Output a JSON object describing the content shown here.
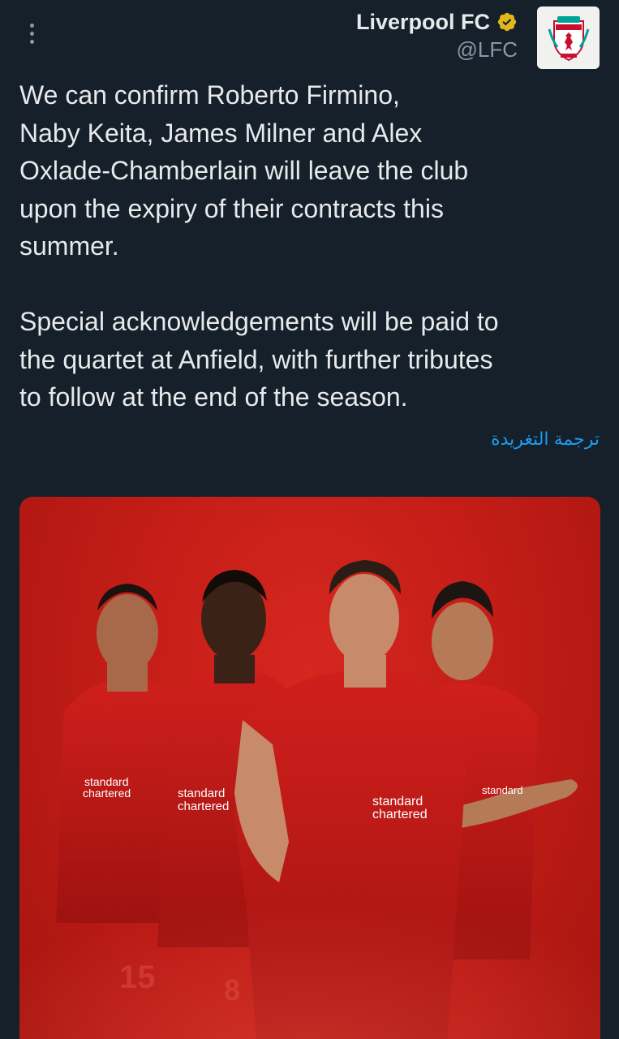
{
  "author": {
    "name": "Liverpool FC",
    "handle": "@LFC",
    "verified_badge_color": "#e2b719"
  },
  "tweet": {
    "text": "We can confirm Roberto Firmino,\nNaby Keita, James Milner and Alex\nOxlade-Chamberlain will leave the club\nupon the expiry of their contracts this\nsummer.\n\nSpecial acknowledgements will be paid to\nthe quartet at Anfield, with further tributes\nto follow at the end of the season.",
    "translate_label": "ترجمة التغريدة"
  },
  "media": {
    "sponsor_lines": [
      "standard",
      "chartered"
    ],
    "shirt_numbers": [
      "15",
      "8"
    ],
    "background_color": "#c41d17"
  },
  "icons": {
    "more": "more-vertical-icon",
    "verified": "verified-badge-icon",
    "avatar": "lfc-crest-icon"
  }
}
